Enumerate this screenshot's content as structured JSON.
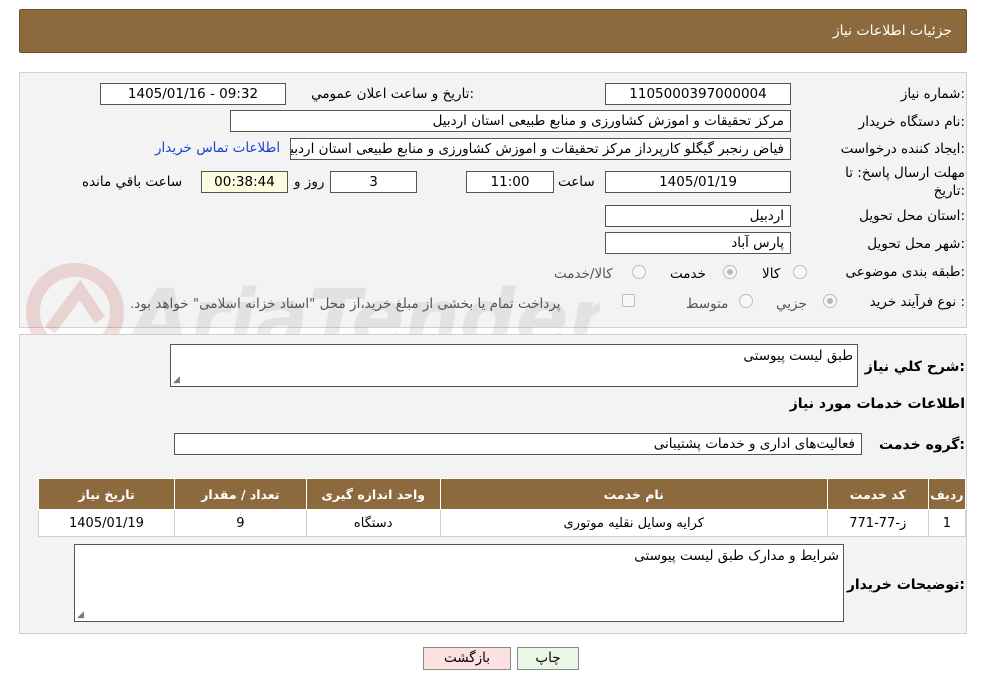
{
  "header": {
    "title": "جزئیات اطلاعات نیاز"
  },
  "form": {
    "need_number_label": "شماره نیاز:",
    "need_number": "1105000397000004",
    "announce_label": "تاريخ و ساعت اعلان عمومي:",
    "announce_value": "1405/01/16 - 09:32",
    "buyer_org_label": "نام دستگاه خريدار:",
    "buyer_org": "مرکز تحقیقات و اموزش کشاورزی و منابع طبیعی استان اردبیل",
    "creator_label": "ايجاد کننده درخواست:",
    "creator": "فیاض رنجبر گیگلو کارپرداز مرکز تحقیقات و اموزش کشاورزی و منابع طبیعی استان اردبیل",
    "contact_link": "اطلاعات تماس خريدار",
    "deadline_label_1": "مهلت ارسال پاسخ: تا",
    "deadline_label_2": "تاريخ:",
    "deadline_date": "1405/01/19",
    "time_label": "ساعت",
    "deadline_time": "11:00",
    "days_value": "3",
    "days_label": "روز و",
    "remaining_value": "00:38:44",
    "remaining_label": "ساعت باقي مانده",
    "province_label": "استان محل تحويل:",
    "province": "اردبیل",
    "city_label": "شهر محل تحويل:",
    "city": "پارس آباد",
    "category_label": "طبقه بندی موضوعی:",
    "category_options": [
      "كالا",
      "خدمت",
      "كالا/خدمت"
    ],
    "category_selected": "خدمت",
    "process_label": "نوع فرآيند خريد :",
    "process_options": [
      "جزيي",
      "متوسط"
    ],
    "process_selected": "جزيي",
    "payment_note": "پرداخت تمام يا بخشی از مبلغ خريد،از محل \"اسناد خزانه اسلامی\" خواهد بود."
  },
  "description": {
    "label": "شرح کلي نياز:",
    "value": "طبق لیست پیوستی"
  },
  "services": {
    "section_title": "اطلاعات خدمات مورد نياز",
    "group_label": "گروه خدمت:",
    "group_value": "فعاليت‌های اداری و خدمات پشتيبانی",
    "columns": [
      "رديف",
      "کد خدمت",
      "نام خدمت",
      "واحد اندازه گيری",
      "تعداد / مقدار",
      "تاريخ نياز"
    ],
    "rows": [
      [
        "1",
        "ز-77-771",
        "کرايه وسايل نقليه موتوری",
        "دستگاه",
        "9",
        "1405/01/19"
      ]
    ]
  },
  "buyer_notes": {
    "label": "توضيحات خريدار:",
    "value": "شرایط و مدارک طبق لیست پیوستی"
  },
  "buttons": {
    "print": "چاپ",
    "back": "بازگشت"
  },
  "watermark": {
    "text": "AriaTender.net"
  },
  "colors": {
    "brand": "#8c6a3e",
    "link": "#1a3fd6",
    "back_button": "#fde0e0",
    "print_button": "#eaf7e4"
  }
}
